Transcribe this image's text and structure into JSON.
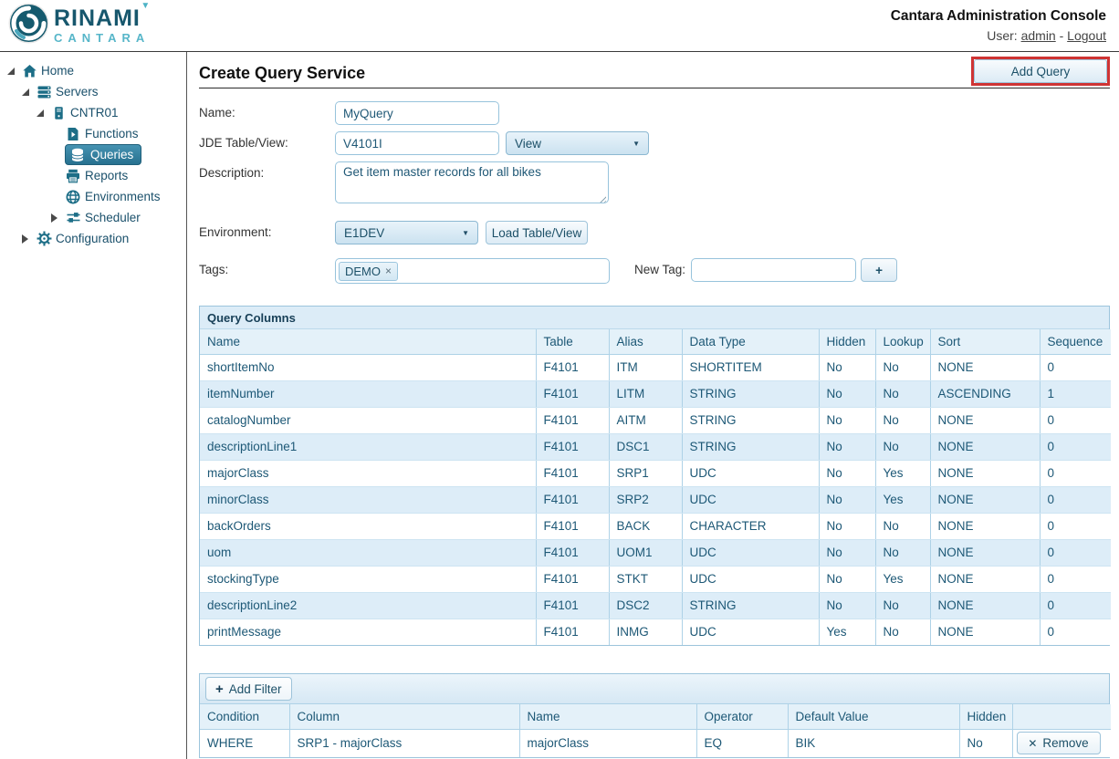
{
  "palette": {
    "accent_teal": "#1d6e87",
    "logo_light_teal": "#57b6c9",
    "selected_item_bg": "#2e7f9e",
    "panel_header_bg": "#dcecf7",
    "row_alt_bg": "#ddedf8",
    "highlight_red": "#cf3434",
    "text_navy": "#1d5876"
  },
  "header": {
    "logo_line1": "RINAMI",
    "logo_caret": "▼",
    "logo_line2": "CANTARA",
    "title": "Cantara Administration Console",
    "user_prefix": "User:",
    "user_name": "admin",
    "dash": "-",
    "logout": "Logout"
  },
  "sidebar": {
    "items": [
      {
        "label": "Home",
        "state": "expanded"
      },
      {
        "label": "Servers",
        "state": "expanded"
      },
      {
        "label": "CNTR01",
        "state": "expanded"
      },
      {
        "label": "Functions",
        "state": "leaf"
      },
      {
        "label": "Queries",
        "state": "leaf",
        "selected": true
      },
      {
        "label": "Reports",
        "state": "leaf"
      },
      {
        "label": "Environments",
        "state": "leaf"
      },
      {
        "label": "Scheduler",
        "state": "collapsed"
      },
      {
        "label": "Configuration",
        "state": "collapsed"
      }
    ]
  },
  "main": {
    "page_title": "Create Query Service",
    "add_query_button": "Add Query",
    "form": {
      "name_label": "Name:",
      "name_value": "MyQuery",
      "table_label": "JDE Table/View:",
      "table_value": "V4101I",
      "table_type_value": "View",
      "dropdown_arrow": "▼",
      "description_label": "Description:",
      "description_value": "Get item master records for all bikes",
      "environment_label": "Environment:",
      "environment_value": "E1DEV",
      "load_button": "Load Table/View",
      "tags_label": "Tags:",
      "tag_chip": "DEMO",
      "tag_remove_icon": "×",
      "new_tag_label": "New Tag:",
      "new_tag_value": "",
      "add_tag_button": "+"
    },
    "columns_panel": {
      "title": "Query Columns",
      "headers": [
        "Name",
        "Table",
        "Alias",
        "Data Type",
        "Hidden",
        "Lookup",
        "Sort",
        "Sequence"
      ],
      "rows": [
        [
          "shortItemNo",
          "F4101",
          "ITM",
          "SHORTITEM",
          "No",
          "No",
          "NONE",
          "0"
        ],
        [
          "itemNumber",
          "F4101",
          "LITM",
          "STRING",
          "No",
          "No",
          "ASCENDING",
          "1"
        ],
        [
          "catalogNumber",
          "F4101",
          "AITM",
          "STRING",
          "No",
          "No",
          "NONE",
          "0"
        ],
        [
          "descriptionLine1",
          "F4101",
          "DSC1",
          "STRING",
          "No",
          "No",
          "NONE",
          "0"
        ],
        [
          "majorClass",
          "F4101",
          "SRP1",
          "UDC",
          "No",
          "Yes",
          "NONE",
          "0"
        ],
        [
          "minorClass",
          "F4101",
          "SRP2",
          "UDC",
          "No",
          "Yes",
          "NONE",
          "0"
        ],
        [
          "backOrders",
          "F4101",
          "BACK",
          "CHARACTER",
          "No",
          "No",
          "NONE",
          "0"
        ],
        [
          "uom",
          "F4101",
          "UOM1",
          "UDC",
          "No",
          "No",
          "NONE",
          "0"
        ],
        [
          "stockingType",
          "F4101",
          "STKT",
          "UDC",
          "No",
          "Yes",
          "NONE",
          "0"
        ],
        [
          "descriptionLine2",
          "F4101",
          "DSC2",
          "STRING",
          "No",
          "No",
          "NONE",
          "0"
        ],
        [
          "printMessage",
          "F4101",
          "INMG",
          "UDC",
          "Yes",
          "No",
          "NONE",
          "0"
        ]
      ]
    },
    "filters_panel": {
      "add_filter_icon": "+",
      "add_filter_label": "Add Filter",
      "headers": [
        "Condition",
        "Column",
        "Name",
        "Operator",
        "Default Value",
        "Hidden",
        ""
      ],
      "row": {
        "condition": "WHERE",
        "column": "SRP1 - majorClass",
        "name": "majorClass",
        "operator": "EQ",
        "default_value": "BIK",
        "hidden": "No",
        "remove_icon": "✕",
        "remove_label": "Remove"
      }
    }
  }
}
